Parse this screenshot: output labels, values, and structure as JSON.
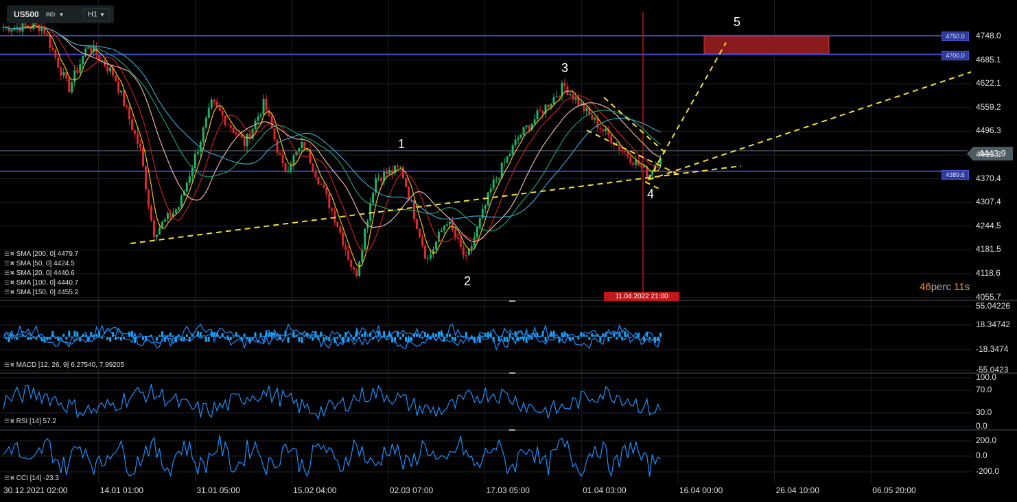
{
  "header": {
    "symbol": "US500",
    "type": "IND",
    "timeframe": "H1"
  },
  "timer": {
    "value": "46",
    "unit": "perc",
    "seconds": "11",
    "seconds_unit": "s"
  },
  "vertical_marker": {
    "label": "11.04.2022 21:00"
  },
  "price_tags": {
    "current": "4443.9",
    "levels": [
      "4750.0",
      "4700.0",
      "4389.6"
    ]
  },
  "wave_labels": [
    "1",
    "2",
    "3",
    "4",
    "5"
  ],
  "legends": {
    "sma": [
      "SMA [200,  0] 4479.7",
      "SMA [50,  0] 4424.5",
      "SMA [20,  0] 4440.6",
      "SMA [100,  0] 4440.7",
      "SMA [150,  0] 4455.2"
    ],
    "macd": "MACD [12, 26, 9] 6.27540,  7.99205",
    "rsi": "RSI [14] 57.2",
    "cci": "CCI [14] -23.3"
  },
  "chart_data": {
    "type": "candlestick",
    "title": "US500 H1",
    "x_tick_labels": [
      "30.12.2021  02:00",
      "14.01  01:00",
      "31.01  05:00",
      "15.02  04:00",
      "02.03  07:00",
      "17.03  05:00",
      "01.04  03:00",
      "16.04  00:00",
      "26.04  10:00",
      "06.05  20:00"
    ],
    "price_axis_ticks": [
      "4748.0",
      "4685.1",
      "4622.1",
      "4559.2",
      "4496.3",
      "4433.3",
      "4370.4",
      "4307.4",
      "4244.5",
      "4181.5",
      "4118.6",
      "4055.7"
    ],
    "ylim": [
      4055.7,
      4780
    ],
    "price_path_days_since_start": [
      0,
      6,
      10,
      13,
      17,
      21,
      23,
      27,
      32,
      37,
      40,
      43,
      46,
      51,
      54,
      57,
      61,
      65,
      68,
      71,
      75,
      79,
      86,
      90,
      94,
      99,
      101
    ],
    "price_path_values": [
      4772,
      4775,
      4608,
      4726,
      4644,
      4444,
      4225,
      4298,
      4571,
      4462,
      4571,
      4389,
      4462,
      4261,
      4107,
      4371,
      4398,
      4152,
      4261,
      4152,
      4352,
      4480,
      4617,
      4535,
      4462,
      4380,
      4440
    ],
    "horizontal_levels": [
      4750.0,
      4700.0,
      4389.6
    ],
    "target_zone": [
      4700,
      4750
    ],
    "macd_panel": {
      "ticks": [
        "55.04226",
        "18.34742",
        "-18.3474",
        "-55.0423"
      ]
    },
    "rsi_panel": {
      "ticks": [
        "100.0",
        "70.0",
        "30.0",
        "0.0"
      ]
    },
    "cci_panel": {
      "ticks": [
        "200.0",
        "0.0",
        "-200.0"
      ]
    },
    "colors": {
      "up": "#1db36a",
      "down": "#e0262f",
      "level": "#3a47c0",
      "trend": "#f5e03a",
      "indicator": "#1e90ff",
      "macd_hist": "#1aa3f0"
    }
  }
}
